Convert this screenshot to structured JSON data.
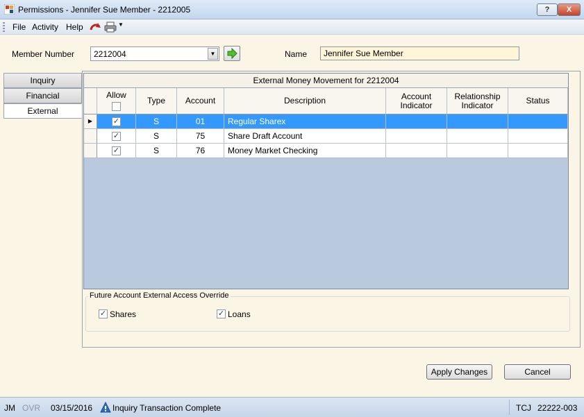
{
  "window": {
    "title": "Permissions - Jennifer Sue Member - 2212005",
    "help_label": "?",
    "close_label": "X"
  },
  "menu": {
    "file": "File",
    "activity": "Activity",
    "help": "Help"
  },
  "form": {
    "member_number_label": "Member Number",
    "member_number_value": "2212004",
    "name_label": "Name",
    "name_value": "Jennifer Sue Member"
  },
  "tabs": [
    {
      "label": "Inquiry"
    },
    {
      "label": "Financial"
    },
    {
      "label": "External"
    }
  ],
  "grid": {
    "caption": "External Money Movement for 2212004",
    "headers": {
      "allow": "Allow",
      "type": "Type",
      "account": "Account",
      "description": "Description",
      "account_indicator": "Account Indicator",
      "relationship_indicator": "Relationship Indicator",
      "status": "Status"
    },
    "rows": [
      {
        "allow": true,
        "type": "S",
        "account": "01",
        "description": "Regular Sharex",
        "account_indicator": "",
        "relationship_indicator": "",
        "status": ""
      },
      {
        "allow": true,
        "type": "S",
        "account": "75",
        "description": "Share Draft Account",
        "account_indicator": "",
        "relationship_indicator": "",
        "status": ""
      },
      {
        "allow": true,
        "type": "S",
        "account": "76",
        "description": "Money Market Checking",
        "account_indicator": "",
        "relationship_indicator": "",
        "status": ""
      }
    ]
  },
  "override": {
    "title": "Future Account External Access Override",
    "shares_label": "Shares",
    "shares_checked": true,
    "loans_label": "Loans",
    "loans_checked": true
  },
  "buttons": {
    "apply": "Apply Changes",
    "cancel": "Cancel"
  },
  "status": {
    "user": "JM",
    "ovr": "OVR",
    "date": "03/15/2016",
    "message": "Inquiry Transaction Complete",
    "tcj": "TCJ",
    "code": "22222-003"
  },
  "colors": {
    "selection": "#3399ff",
    "grid_background": "#b9c9de",
    "form_background": "#fbf5e6"
  }
}
